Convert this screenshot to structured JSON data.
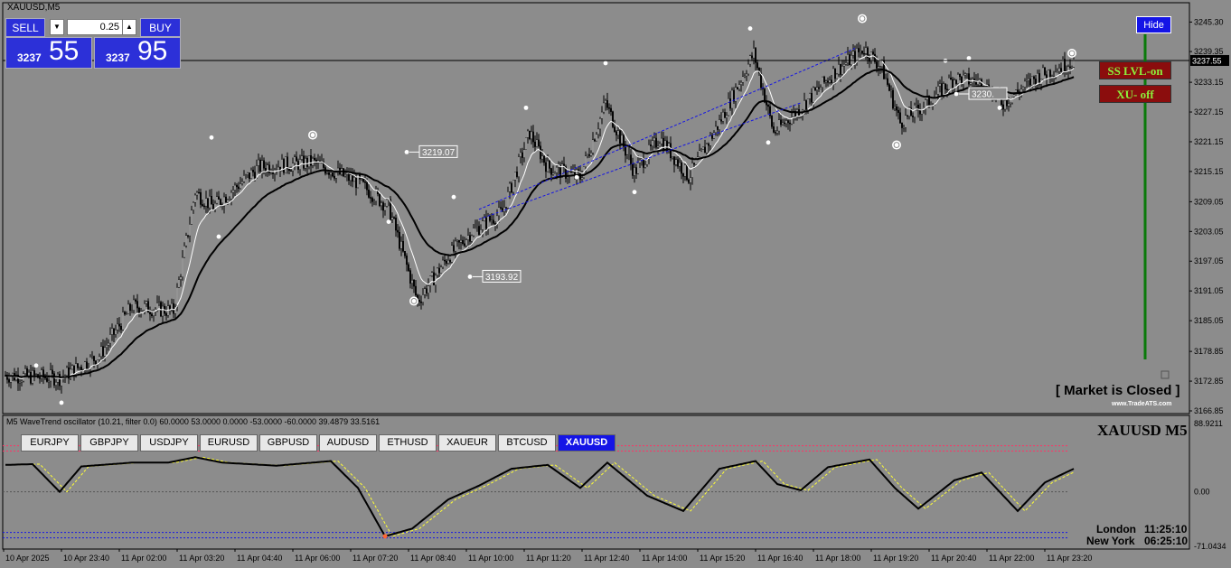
{
  "window": {
    "title": "XAUUSD,M5"
  },
  "trade_panel": {
    "sell_label": "SELL",
    "buy_label": "BUY",
    "lot_value": "0.25",
    "bid_small": "3237",
    "bid_big": "55",
    "ask_small": "3237",
    "ask_big": "95"
  },
  "buttons": {
    "hide": "Hide",
    "ss_lvl": "SS LVL-on",
    "xu": "XU- off"
  },
  "status": {
    "market": "[ Market is Closed ]",
    "brand": "www.TradeATS.com"
  },
  "price_axis": {
    "ticks": [
      "3245.30",
      "3239.35",
      "3233.15",
      "3227.15",
      "3221.15",
      "3215.15",
      "3209.05",
      "3203.05",
      "3197.05",
      "3191.05",
      "3185.05",
      "3178.85",
      "3172.85",
      "3166.85"
    ],
    "current": "3237.55",
    "range": [
      3166.85,
      3247.2
    ]
  },
  "time_axis": [
    "10 Apr 2025",
    "10 Apr 23:40",
    "11 Apr 02:00",
    "11 Apr 03:20",
    "11 Apr 04:40",
    "11 Apr 06:00",
    "11 Apr 07:20",
    "11 Apr 08:40",
    "11 Apr 10:00",
    "11 Apr 11:20",
    "11 Apr 12:40",
    "11 Apr 14:00",
    "11 Apr 15:20",
    "11 Apr 16:40",
    "11 Apr 18:00",
    "11 Apr 19:20",
    "11 Apr 20:40",
    "11 Apr 22:00",
    "11 Apr 23:20"
  ],
  "annotations": [
    {
      "text": "3219.07",
      "bar": 222,
      "price": 3219.07
    },
    {
      "text": "3193.92",
      "bar": 257,
      "price": 3193.92
    },
    {
      "text": "3230.",
      "bar": 526,
      "price": 3230.8
    }
  ],
  "oscillator": {
    "label": "M5 WaveTrend oscillator (10.21, filter 0.0) 60.0000 53.0000 0.0000 -53.0000 -60.0000 39.4879 33.5161",
    "symbol": "XAUUSD  M5",
    "ticks": [
      "88.9211",
      "0.00",
      "-71.0434"
    ],
    "range": [
      -71.0434,
      88.9211
    ]
  },
  "symbols": [
    "EURJPY",
    "GBPJPY",
    "USDJPY",
    "EURUSD",
    "GBPUSD",
    "AUDUSD",
    "ETHUSD",
    "XAUEUR",
    "BTCUSD",
    "XAUUSD"
  ],
  "active_symbol": "XAUUSD",
  "clocks": [
    {
      "city": "London",
      "time": "11:25:10"
    },
    {
      "city": "New York",
      "time": "06:25:10"
    }
  ],
  "colors": {
    "background": "#8c8c8c",
    "accent": "#1414e6",
    "red_button": "#8b0d0d",
    "green_text": "#8cf03c"
  },
  "icons": {
    "sell_arrow": "triangle-down-icon",
    "buy_arrow": "triangle-up-icon"
  },
  "chart_data": {
    "type": "candlestick",
    "x_range": [
      "10 Apr 2025",
      "11 Apr 23:20"
    ],
    "ylim": [
      3166.85,
      3247.2
    ],
    "last_price": 3237.55,
    "key_points": [
      {
        "bar": 0,
        "price": 3174.0
      },
      {
        "bar": 30,
        "price": 3173.5
      },
      {
        "bar": 52,
        "price": 3178.0
      },
      {
        "bar": 70,
        "price": 3188.0
      },
      {
        "bar": 93,
        "price": 3187.0
      },
      {
        "bar": 105,
        "price": 3211.0
      },
      {
        "bar": 115,
        "price": 3208.0
      },
      {
        "bar": 140,
        "price": 3216.0
      },
      {
        "bar": 170,
        "price": 3217.0
      },
      {
        "bar": 195,
        "price": 3213.0
      },
      {
        "bar": 212,
        "price": 3208.0
      },
      {
        "bar": 228,
        "price": 3189.0
      },
      {
        "bar": 245,
        "price": 3198.0
      },
      {
        "bar": 258,
        "price": 3203.0
      },
      {
        "bar": 275,
        "price": 3207.0
      },
      {
        "bar": 290,
        "price": 3223.0
      },
      {
        "bar": 300,
        "price": 3216.0
      },
      {
        "bar": 318,
        "price": 3214.0
      },
      {
        "bar": 332,
        "price": 3229.0
      },
      {
        "bar": 348,
        "price": 3215.0
      },
      {
        "bar": 362,
        "price": 3222.0
      },
      {
        "bar": 378,
        "price": 3214.0
      },
      {
        "bar": 395,
        "price": 3225.0
      },
      {
        "bar": 414,
        "price": 3239.0
      },
      {
        "bar": 425,
        "price": 3223.0
      },
      {
        "bar": 440,
        "price": 3228.0
      },
      {
        "bar": 458,
        "price": 3235.0
      },
      {
        "bar": 475,
        "price": 3240.0
      },
      {
        "bar": 485,
        "price": 3236.0
      },
      {
        "bar": 495,
        "price": 3225.0
      },
      {
        "bar": 510,
        "price": 3229.0
      },
      {
        "bar": 525,
        "price": 3234.0
      },
      {
        "bar": 540,
        "price": 3233.0
      },
      {
        "bar": 552,
        "price": 3229.0
      },
      {
        "bar": 570,
        "price": 3234.0
      },
      {
        "bar": 591,
        "price": 3237.55
      }
    ],
    "wavetrend": [
      {
        "bar": 0,
        "value": 35
      },
      {
        "bar": 15,
        "value": 36
      },
      {
        "bar": 30,
        "value": 0
      },
      {
        "bar": 42,
        "value": 33
      },
      {
        "bar": 70,
        "value": 38
      },
      {
        "bar": 90,
        "value": 38
      },
      {
        "bar": 105,
        "value": 45
      },
      {
        "bar": 120,
        "value": 38
      },
      {
        "bar": 150,
        "value": 34
      },
      {
        "bar": 180,
        "value": 40
      },
      {
        "bar": 195,
        "value": 5
      },
      {
        "bar": 210,
        "value": -58
      },
      {
        "bar": 225,
        "value": -48
      },
      {
        "bar": 245,
        "value": -10
      },
      {
        "bar": 262,
        "value": 8
      },
      {
        "bar": 280,
        "value": 30
      },
      {
        "bar": 300,
        "value": 35
      },
      {
        "bar": 318,
        "value": 5
      },
      {
        "bar": 333,
        "value": 38
      },
      {
        "bar": 355,
        "value": -5
      },
      {
        "bar": 375,
        "value": -25
      },
      {
        "bar": 395,
        "value": 30
      },
      {
        "bar": 415,
        "value": 40
      },
      {
        "bar": 427,
        "value": 10
      },
      {
        "bar": 440,
        "value": 2
      },
      {
        "bar": 455,
        "value": 32
      },
      {
        "bar": 478,
        "value": 42
      },
      {
        "bar": 492,
        "value": 5
      },
      {
        "bar": 505,
        "value": -22
      },
      {
        "bar": 525,
        "value": 15
      },
      {
        "bar": 540,
        "value": 25
      },
      {
        "bar": 552,
        "value": -5
      },
      {
        "bar": 560,
        "value": -25
      },
      {
        "bar": 575,
        "value": 12
      },
      {
        "bar": 591,
        "value": 30
      }
    ]
  }
}
